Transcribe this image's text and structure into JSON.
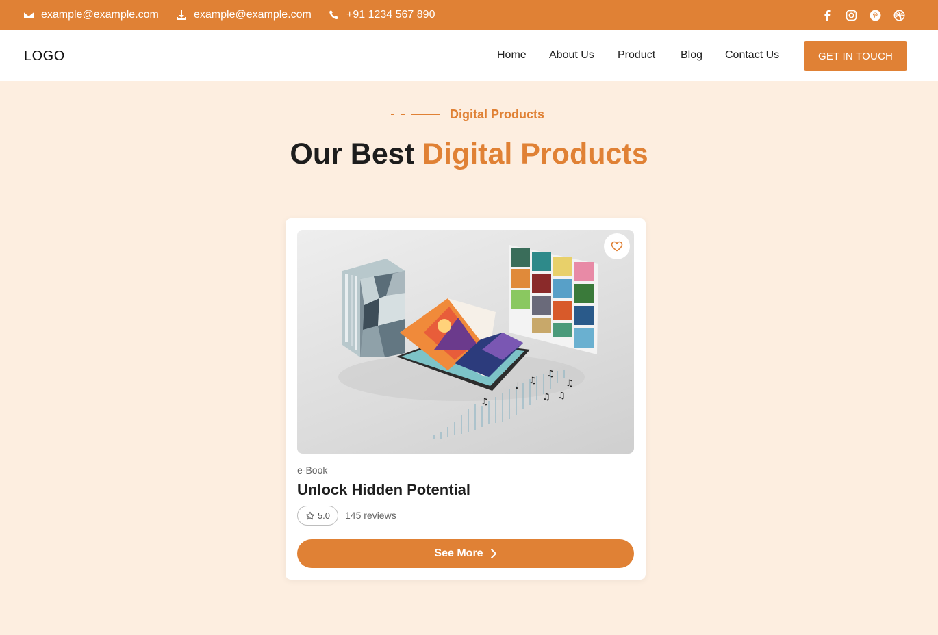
{
  "topbar": {
    "email_1": "example@example.com",
    "email_2": "example@example.com",
    "phone": "+91 1234 567 890",
    "social_icons": [
      "facebook-icon",
      "instagram-icon",
      "pinterest-icon",
      "dribbble-icon"
    ]
  },
  "header": {
    "logo": "LOGO",
    "nav": [
      "Home",
      "About Us",
      "Product",
      "Blog",
      "Contact Us"
    ],
    "cta": "GET IN TOUCH"
  },
  "section": {
    "eyebrow": "Digital Products",
    "title_plain": "Our Best ",
    "title_accent": "Digital Products"
  },
  "product": {
    "category": "e-Book",
    "title": "Unlock Hidden Potential",
    "rating": "5.0",
    "reviews": "145 reviews",
    "button": "See More"
  },
  "colors": {
    "accent": "#e08135",
    "background": "#fdeee0",
    "card": "#ffffff"
  }
}
